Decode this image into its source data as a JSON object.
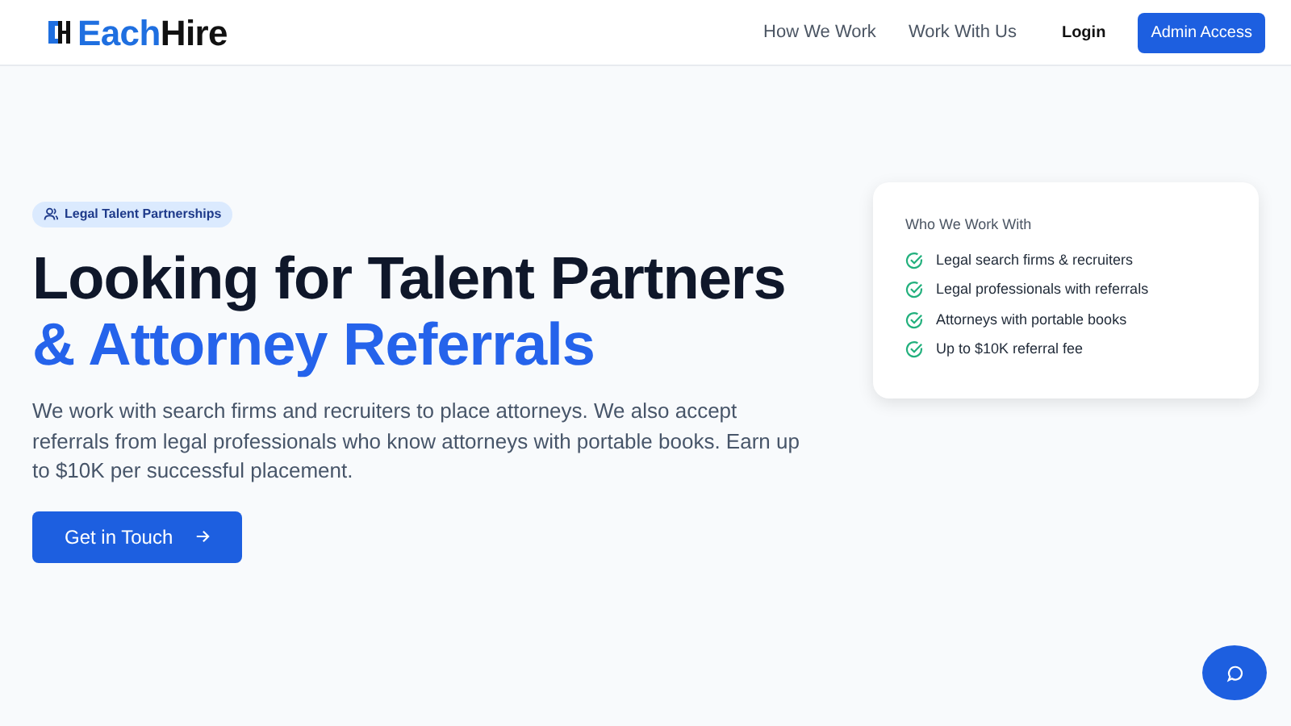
{
  "brand": {
    "accent": "Each",
    "rest": "Hire"
  },
  "nav": {
    "links": [
      "How We Work",
      "Work With Us"
    ],
    "login": "Login",
    "cta": "Admin Access"
  },
  "hero": {
    "badge": "Legal Talent Partnerships",
    "title_lines": [
      {
        "text": "Looking for Talent Partners",
        "highlighted": false
      },
      {
        "text": "& Attorney Referrals",
        "highlighted": true
      }
    ],
    "description": "We work with search firms and recruiters to place attorneys. We also accept referrals from legal professionals who know attorneys with portable books. Earn up to $10K per successful placement.",
    "button": "Get in Touch"
  },
  "card": {
    "title": "Who We Work With",
    "items": [
      "Legal search firms & recruiters",
      "Legal professionals with referrals",
      "Attorneys with portable books",
      "Up to $10K referral fee"
    ]
  }
}
